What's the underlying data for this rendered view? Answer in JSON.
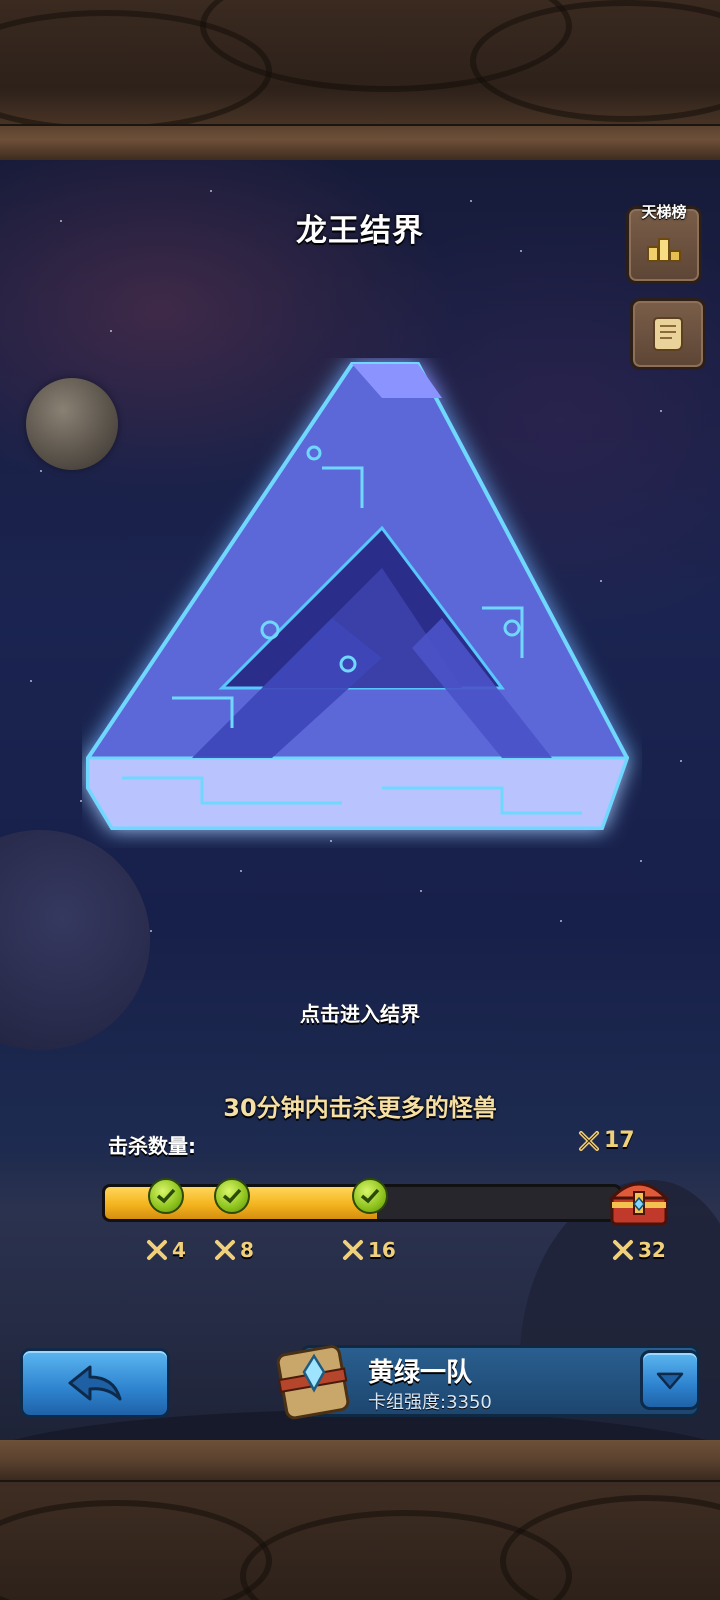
{
  "header": {
    "title": "龙王结界"
  },
  "side_buttons": {
    "ladder_label": "天梯榜",
    "ladder_icon": "podium-icon",
    "rules_icon": "scroll-icon"
  },
  "main": {
    "enter_hint": "点击进入结界",
    "goal": "30分钟内击杀更多的怪兽",
    "kill_label": "击杀数量:",
    "current_kills": "17",
    "progress_fraction": 0.53,
    "milestones": [
      {
        "label": "4",
        "reached": true
      },
      {
        "label": "8",
        "reached": true
      },
      {
        "label": "16",
        "reached": true
      },
      {
        "label": "32",
        "reached": false
      }
    ]
  },
  "footer": {
    "back_icon": "back-arrow-icon",
    "team_name": "黄绿一队",
    "team_power": "卡组强度:3350",
    "dropdown_icon": "chevron-down-icon"
  },
  "colors": {
    "progress_fill": "#f4b41e",
    "button_blue": "#2e83cf",
    "milestone_text": "#f0d07a",
    "goal_text": "#f5dfa4"
  }
}
